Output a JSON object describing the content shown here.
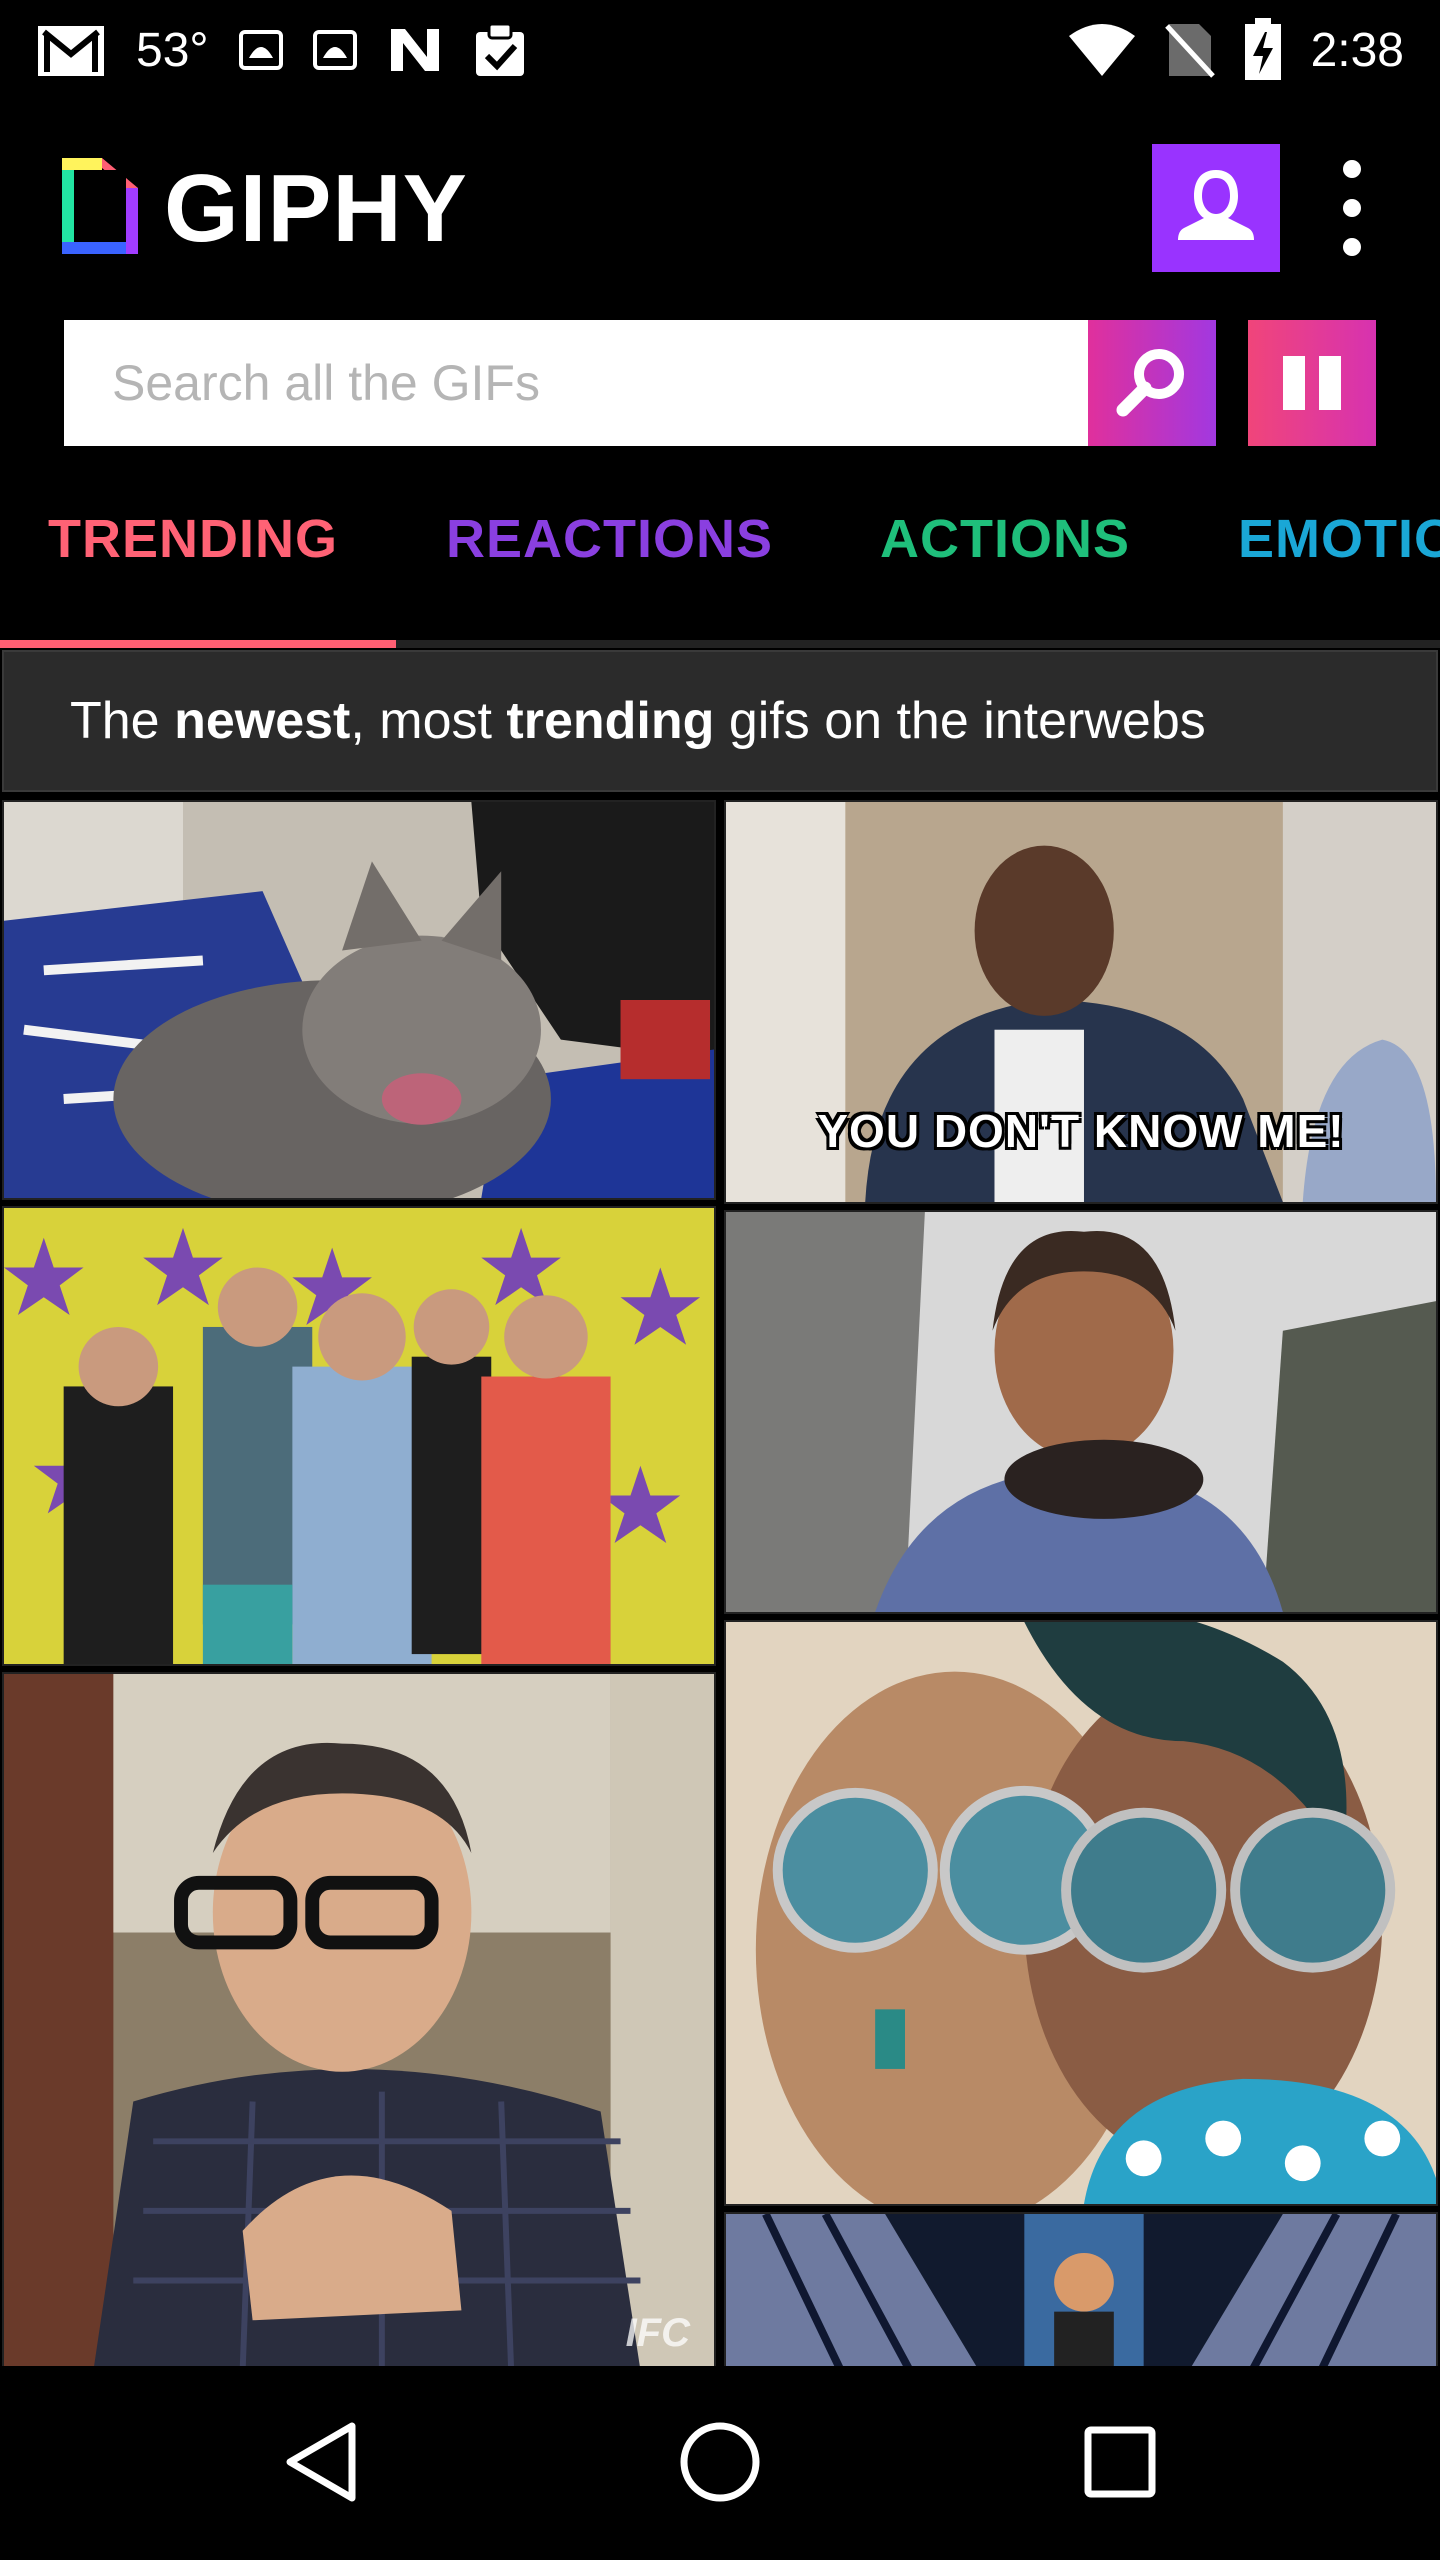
{
  "status_bar": {
    "temperature": "53°",
    "time": "2:38",
    "icons": [
      "gmail-icon",
      "huawei-icon",
      "huawei-icon",
      "n-app-icon",
      "clipboard-check-icon",
      "wifi-icon",
      "no-sim-icon",
      "battery-charging-icon"
    ]
  },
  "header": {
    "logo_text": "GIPHY",
    "profile_icon": "user-silhouette-icon",
    "menu_icon": "overflow-menu-icon"
  },
  "search": {
    "placeholder": "Search all the GIFs",
    "value": "",
    "search_icon": "magnifier-icon",
    "pause_icon": "pause-icon"
  },
  "tabs": [
    {
      "label": "TRENDING",
      "color": "#ff6275",
      "selected": true
    },
    {
      "label": "REACTIONS",
      "color": "#8a3fe0",
      "selected": false
    },
    {
      "label": "ACTIONS",
      "color": "#1fbf7b",
      "selected": false
    },
    {
      "label": "EMOTIONS",
      "color": "#1aa7d6",
      "selected": false
    }
  ],
  "banner": {
    "part1": "The ",
    "bold1": "newest",
    "part2": ", most ",
    "bold2": "trending",
    "part3": " gifs on the interwebs"
  },
  "gifs": [
    {
      "caption": ""
    },
    {
      "caption": "YOU DON'T KNOW ME!"
    },
    {
      "caption": ""
    },
    {
      "caption": ""
    },
    {
      "caption": "",
      "watermark": "IFC"
    },
    {
      "caption": ""
    },
    {
      "caption": ""
    }
  ],
  "nav": {
    "back": "back-icon",
    "home": "home-icon",
    "recents": "recents-icon"
  },
  "colors": {
    "accent_purple": "#9933ff",
    "tab_indicator": "#ff5f73",
    "search_button": "#c236c8",
    "pause_button": "#e23b98"
  }
}
